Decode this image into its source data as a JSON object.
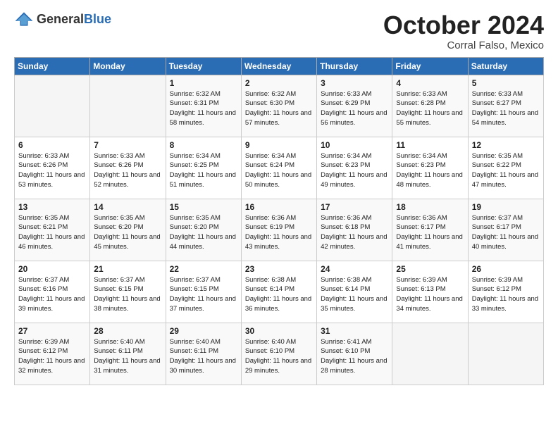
{
  "header": {
    "logo_general": "General",
    "logo_blue": "Blue",
    "title": "October 2024",
    "location": "Corral Falso, Mexico"
  },
  "days_of_week": [
    "Sunday",
    "Monday",
    "Tuesday",
    "Wednesday",
    "Thursday",
    "Friday",
    "Saturday"
  ],
  "weeks": [
    [
      {
        "day": null,
        "info": null
      },
      {
        "day": null,
        "info": null
      },
      {
        "day": "1",
        "info": "Sunrise: 6:32 AM\nSunset: 6:31 PM\nDaylight: 11 hours and 58 minutes."
      },
      {
        "day": "2",
        "info": "Sunrise: 6:32 AM\nSunset: 6:30 PM\nDaylight: 11 hours and 57 minutes."
      },
      {
        "day": "3",
        "info": "Sunrise: 6:33 AM\nSunset: 6:29 PM\nDaylight: 11 hours and 56 minutes."
      },
      {
        "day": "4",
        "info": "Sunrise: 6:33 AM\nSunset: 6:28 PM\nDaylight: 11 hours and 55 minutes."
      },
      {
        "day": "5",
        "info": "Sunrise: 6:33 AM\nSunset: 6:27 PM\nDaylight: 11 hours and 54 minutes."
      }
    ],
    [
      {
        "day": "6",
        "info": "Sunrise: 6:33 AM\nSunset: 6:26 PM\nDaylight: 11 hours and 53 minutes."
      },
      {
        "day": "7",
        "info": "Sunrise: 6:33 AM\nSunset: 6:26 PM\nDaylight: 11 hours and 52 minutes."
      },
      {
        "day": "8",
        "info": "Sunrise: 6:34 AM\nSunset: 6:25 PM\nDaylight: 11 hours and 51 minutes."
      },
      {
        "day": "9",
        "info": "Sunrise: 6:34 AM\nSunset: 6:24 PM\nDaylight: 11 hours and 50 minutes."
      },
      {
        "day": "10",
        "info": "Sunrise: 6:34 AM\nSunset: 6:23 PM\nDaylight: 11 hours and 49 minutes."
      },
      {
        "day": "11",
        "info": "Sunrise: 6:34 AM\nSunset: 6:23 PM\nDaylight: 11 hours and 48 minutes."
      },
      {
        "day": "12",
        "info": "Sunrise: 6:35 AM\nSunset: 6:22 PM\nDaylight: 11 hours and 47 minutes."
      }
    ],
    [
      {
        "day": "13",
        "info": "Sunrise: 6:35 AM\nSunset: 6:21 PM\nDaylight: 11 hours and 46 minutes."
      },
      {
        "day": "14",
        "info": "Sunrise: 6:35 AM\nSunset: 6:20 PM\nDaylight: 11 hours and 45 minutes."
      },
      {
        "day": "15",
        "info": "Sunrise: 6:35 AM\nSunset: 6:20 PM\nDaylight: 11 hours and 44 minutes."
      },
      {
        "day": "16",
        "info": "Sunrise: 6:36 AM\nSunset: 6:19 PM\nDaylight: 11 hours and 43 minutes."
      },
      {
        "day": "17",
        "info": "Sunrise: 6:36 AM\nSunset: 6:18 PM\nDaylight: 11 hours and 42 minutes."
      },
      {
        "day": "18",
        "info": "Sunrise: 6:36 AM\nSunset: 6:17 PM\nDaylight: 11 hours and 41 minutes."
      },
      {
        "day": "19",
        "info": "Sunrise: 6:37 AM\nSunset: 6:17 PM\nDaylight: 11 hours and 40 minutes."
      }
    ],
    [
      {
        "day": "20",
        "info": "Sunrise: 6:37 AM\nSunset: 6:16 PM\nDaylight: 11 hours and 39 minutes."
      },
      {
        "day": "21",
        "info": "Sunrise: 6:37 AM\nSunset: 6:15 PM\nDaylight: 11 hours and 38 minutes."
      },
      {
        "day": "22",
        "info": "Sunrise: 6:37 AM\nSunset: 6:15 PM\nDaylight: 11 hours and 37 minutes."
      },
      {
        "day": "23",
        "info": "Sunrise: 6:38 AM\nSunset: 6:14 PM\nDaylight: 11 hours and 36 minutes."
      },
      {
        "day": "24",
        "info": "Sunrise: 6:38 AM\nSunset: 6:14 PM\nDaylight: 11 hours and 35 minutes."
      },
      {
        "day": "25",
        "info": "Sunrise: 6:39 AM\nSunset: 6:13 PM\nDaylight: 11 hours and 34 minutes."
      },
      {
        "day": "26",
        "info": "Sunrise: 6:39 AM\nSunset: 6:12 PM\nDaylight: 11 hours and 33 minutes."
      }
    ],
    [
      {
        "day": "27",
        "info": "Sunrise: 6:39 AM\nSunset: 6:12 PM\nDaylight: 11 hours and 32 minutes."
      },
      {
        "day": "28",
        "info": "Sunrise: 6:40 AM\nSunset: 6:11 PM\nDaylight: 11 hours and 31 minutes."
      },
      {
        "day": "29",
        "info": "Sunrise: 6:40 AM\nSunset: 6:11 PM\nDaylight: 11 hours and 30 minutes."
      },
      {
        "day": "30",
        "info": "Sunrise: 6:40 AM\nSunset: 6:10 PM\nDaylight: 11 hours and 29 minutes."
      },
      {
        "day": "31",
        "info": "Sunrise: 6:41 AM\nSunset: 6:10 PM\nDaylight: 11 hours and 28 minutes."
      },
      {
        "day": null,
        "info": null
      },
      {
        "day": null,
        "info": null
      }
    ]
  ]
}
